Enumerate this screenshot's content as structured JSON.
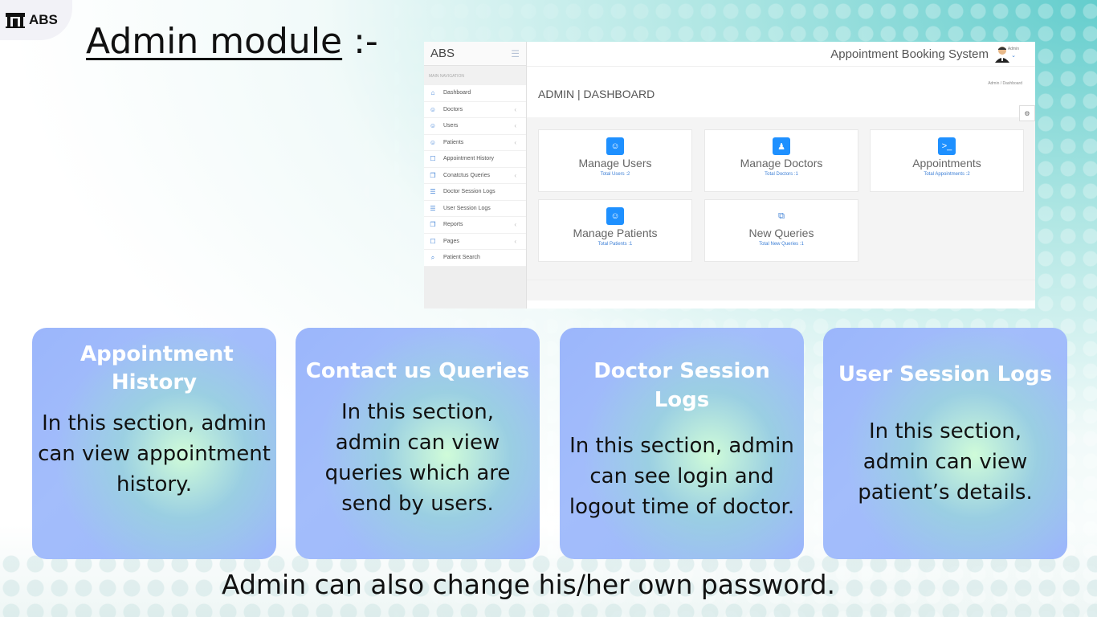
{
  "slide": {
    "logo_text": "ABS",
    "title_main": "Admin module",
    "title_suffix": " :-",
    "bottom_note": "Admin can also change his/her own password."
  },
  "screenshot": {
    "brand": "ABS",
    "nav_header": "MAIN NAVIGATION",
    "nav_items": [
      {
        "label": "Dashboard",
        "icon": "home-icon",
        "has_chevron": false
      },
      {
        "label": "Doctors",
        "icon": "user-icon",
        "has_chevron": true
      },
      {
        "label": "Users",
        "icon": "user-icon",
        "has_chevron": true
      },
      {
        "label": "Patients",
        "icon": "user-icon",
        "has_chevron": true
      },
      {
        "label": "Appointment History",
        "icon": "file-icon",
        "has_chevron": false
      },
      {
        "label": "Conatctus Queries",
        "icon": "files-icon",
        "has_chevron": true
      },
      {
        "label": "Doctor Session Logs",
        "icon": "list-icon",
        "has_chevron": false
      },
      {
        "label": "User Session Logs",
        "icon": "list-icon",
        "has_chevron": false
      },
      {
        "label": "Reports",
        "icon": "files-icon",
        "has_chevron": true
      },
      {
        "label": "Pages",
        "icon": "file-icon",
        "has_chevron": true
      },
      {
        "label": "Patient Search",
        "icon": "search-icon",
        "has_chevron": false
      }
    ],
    "app_title": "Appointment Booking System",
    "admin_label": "Admin",
    "page_title": "ADMIN | DASHBOARD",
    "breadcrumb": "Admin   /  Dashboard",
    "cards": [
      {
        "title": "Manage Users",
        "sub": "Total Users :2",
        "icon": "smiley-icon"
      },
      {
        "title": "Manage Doctors",
        "sub": "Total Doctors :1",
        "icon": "users-icon"
      },
      {
        "title": "Appointments",
        "sub": "Total Appointments :2",
        "icon": "terminal-icon"
      },
      {
        "title": "Manage Patients",
        "sub": "Total Patients :1",
        "icon": "smiley-icon"
      },
      {
        "title": "New Queries",
        "sub": "Total New Queries :1",
        "icon": "files-icon"
      }
    ]
  },
  "features": [
    {
      "heading": "Appointment History",
      "body": "In this section, admin can view appointment history."
    },
    {
      "heading": "Contact us Queries",
      "body": "In this section, admin can view queries which are send by users."
    },
    {
      "heading": "Doctor Session Logs",
      "body": "In this section, admin can see login and logout time of doctor."
    },
    {
      "heading": "User Session Logs",
      "body": "In this section, admin can view patient’s details."
    }
  ],
  "colors": {
    "accent_blue": "#1e90ff",
    "card_blue": "#9bb6fb",
    "teal_bg": "#48c4c4"
  }
}
